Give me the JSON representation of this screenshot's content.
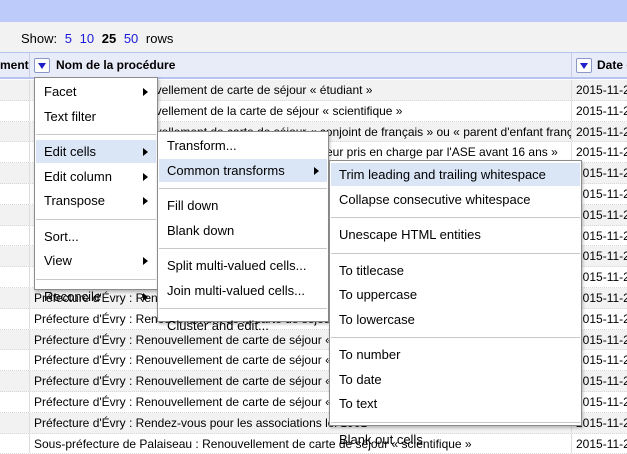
{
  "toolbar": {
    "show_label": "Show:",
    "options": [
      "5",
      "10",
      "25",
      "50"
    ],
    "selected": "25",
    "rows_label": "rows"
  },
  "columns": [
    "ment",
    "Nom de la procédure",
    "Date c"
  ],
  "rows": [
    {
      "name": "uvellement de carte de séjour « étudiant »",
      "date": "2015-11-2",
      "offset": true
    },
    {
      "name": "uvellement de la carte de séjour « scientifique »",
      "date": "2015-11-2",
      "offset": true
    },
    {
      "name": "uvellement de carte de séjour « conjoint de français » ou « parent d'enfant français »",
      "date": "2015-11-2",
      "offset": true
    },
    {
      "name": "eur pris en charge par l'ASE avant 16 ans »",
      "date": "2015-11-2",
      "offset2": true
    },
    {
      "name": "",
      "date": "2015-11-2"
    },
    {
      "name": "",
      "date": "2015-11-2"
    },
    {
      "name": "",
      "date": "2015-11-2"
    },
    {
      "name": "",
      "date": "2015-11-2"
    },
    {
      "name": "",
      "date": "2015-11-2"
    },
    {
      "name": "",
      "date": "2015-11-2"
    },
    {
      "name": "Préfecture d'Évry : Renou",
      "date": "2015-11-2"
    },
    {
      "name": "Préfecture d'Évry : Renouvellement de la carte de séjour « s",
      "date": "2015-11-2"
    },
    {
      "name": "Préfecture d'Évry : Renouvellement de carte de séjour « con",
      "date": "2015-11-2"
    },
    {
      "name": "Préfecture d'Évry : Renouvellement de carte de séjour « min",
      "date": "2015-11-2"
    },
    {
      "name": "Préfecture d'Évry : Renouvellement de carte de séjour « min",
      "date": "2015-11-2"
    },
    {
      "name": "Préfecture d'Évry : Renouvellement de carte de séjour « sala",
      "date": "2015-11-2"
    },
    {
      "name": "Préfecture d'Évry : Rendez-vous pour les associations loi 1901",
      "date": "2015-11-2"
    },
    {
      "name": "Sous-préfecture de Palaiseau : Renouvellement de carte de séjour « scientifique »",
      "date": "2015-11-2"
    }
  ],
  "menus": {
    "column_menu": [
      {
        "label": "Facet",
        "sub": true
      },
      {
        "label": "Text filter"
      },
      {
        "sep": true
      },
      {
        "label": "Edit cells",
        "sub": true,
        "active": true
      },
      {
        "label": "Edit column",
        "sub": true
      },
      {
        "label": "Transpose",
        "sub": true
      },
      {
        "sep": true
      },
      {
        "label": "Sort..."
      },
      {
        "label": "View",
        "sub": true
      },
      {
        "sep": true
      },
      {
        "label": "Reconcile",
        "sub": true
      }
    ],
    "edit_cells": [
      {
        "label": "Transform..."
      },
      {
        "label": "Common transforms",
        "sub": true,
        "active": true
      },
      {
        "sep": true
      },
      {
        "label": "Fill down"
      },
      {
        "label": "Blank down"
      },
      {
        "sep": true
      },
      {
        "label": "Split multi-valued cells..."
      },
      {
        "label": "Join multi-valued cells..."
      },
      {
        "sep": true
      },
      {
        "label": "Cluster and edit..."
      }
    ],
    "common_transforms": [
      {
        "label": "Trim leading and trailing whitespace",
        "active": true
      },
      {
        "label": "Collapse consecutive whitespace"
      },
      {
        "sep": true
      },
      {
        "label": "Unescape HTML entities"
      },
      {
        "sep": true
      },
      {
        "label": "To titlecase"
      },
      {
        "label": "To uppercase"
      },
      {
        "label": "To lowercase"
      },
      {
        "sep": true
      },
      {
        "label": "To number"
      },
      {
        "label": "To date"
      },
      {
        "label": "To text"
      },
      {
        "sep": true
      },
      {
        "label": "Blank out cells"
      }
    ]
  },
  "colors": {
    "top_bar": "#bccbfa",
    "highlight": "#dae5f5",
    "link": "#1a1adb"
  }
}
